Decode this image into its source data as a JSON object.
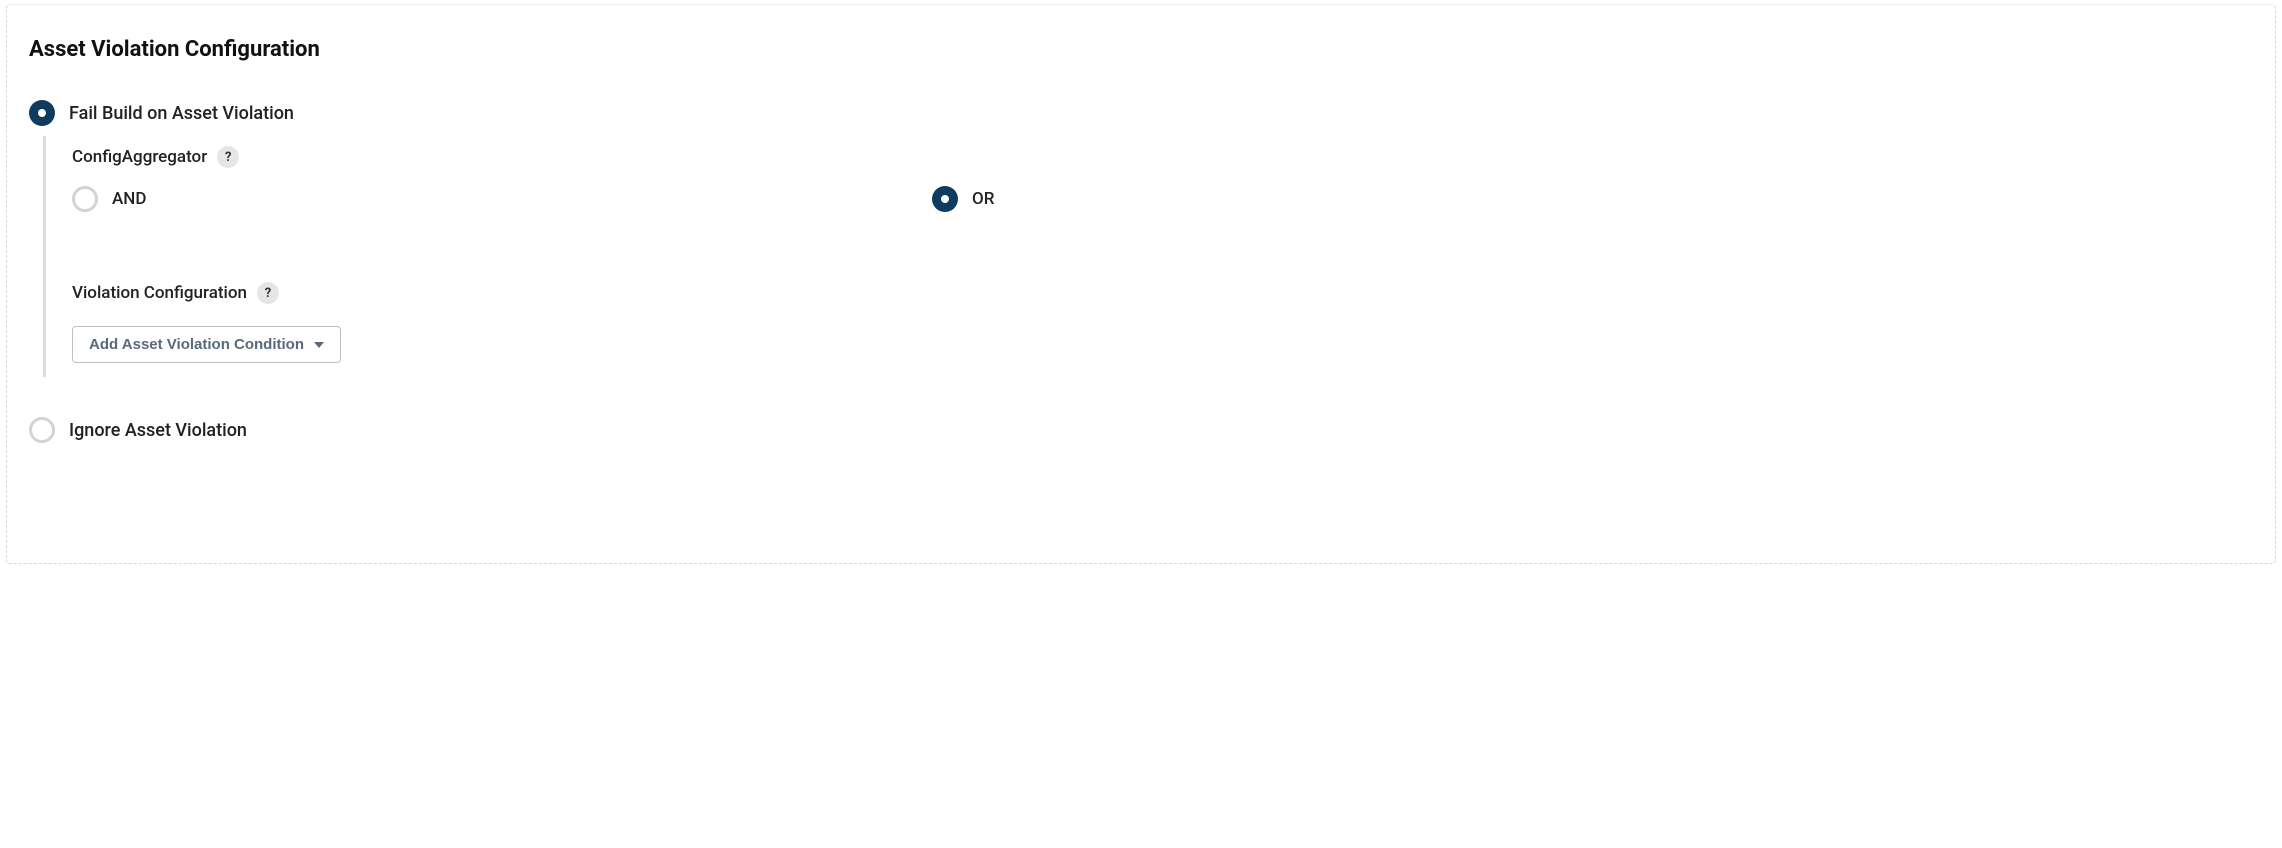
{
  "section": {
    "title": "Asset Violation Configuration"
  },
  "option_fail": {
    "label": "Fail Build on Asset Violation",
    "selected": true
  },
  "option_ignore": {
    "label": "Ignore Asset Violation",
    "selected": false
  },
  "config_aggregator": {
    "label": "ConfigAggregator",
    "help": "?",
    "options": {
      "and": {
        "label": "AND",
        "selected": false
      },
      "or": {
        "label": "OR",
        "selected": true
      }
    }
  },
  "violation_config": {
    "label": "Violation Configuration",
    "help": "?",
    "add_button": "Add Asset Violation Condition"
  }
}
